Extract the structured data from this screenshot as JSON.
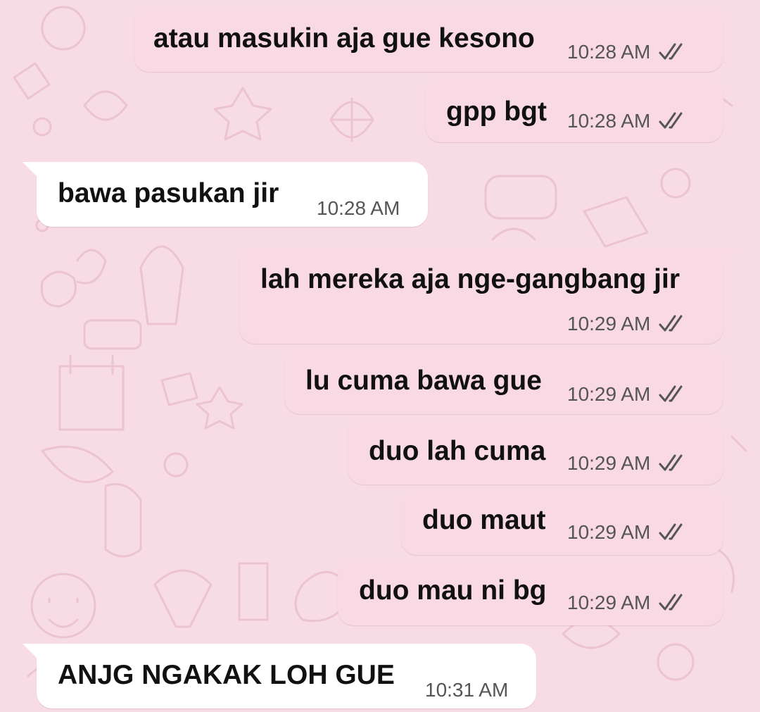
{
  "messages": [
    {
      "direction": "out",
      "text": "atau masukin aja gue kesono",
      "time": "10:28 AM",
      "read_icon": "double-check-icon"
    },
    {
      "direction": "out",
      "text": "gpp bgt",
      "time": "10:28 AM",
      "read_icon": "double-check-icon"
    },
    {
      "direction": "in",
      "text": "bawa pasukan jir",
      "time": "10:28 AM"
    },
    {
      "direction": "out",
      "text": "lah mereka aja nge-gangbang jir",
      "time": "10:29 AM",
      "read_icon": "double-check-icon"
    },
    {
      "direction": "out",
      "text": "lu cuma bawa gue",
      "time": "10:29 AM",
      "read_icon": "double-check-icon"
    },
    {
      "direction": "out",
      "text": "duo lah cuma",
      "time": "10:29 AM",
      "read_icon": "double-check-icon"
    },
    {
      "direction": "out",
      "text": "duo maut",
      "time": "10:29 AM",
      "read_icon": "double-check-icon"
    },
    {
      "direction": "out",
      "text": "duo mau ni bg",
      "time": "10:29 AM",
      "read_icon": "double-check-icon"
    },
    {
      "direction": "in",
      "text": "ANJG NGAKAK LOH GUE",
      "time": "10:31 AM"
    }
  ],
  "colors": {
    "background": "#f7dce5",
    "outgoing_bubble": "#f9d9e3",
    "incoming_bubble": "#ffffff",
    "text": "#111111",
    "meta_text": "#555555"
  }
}
